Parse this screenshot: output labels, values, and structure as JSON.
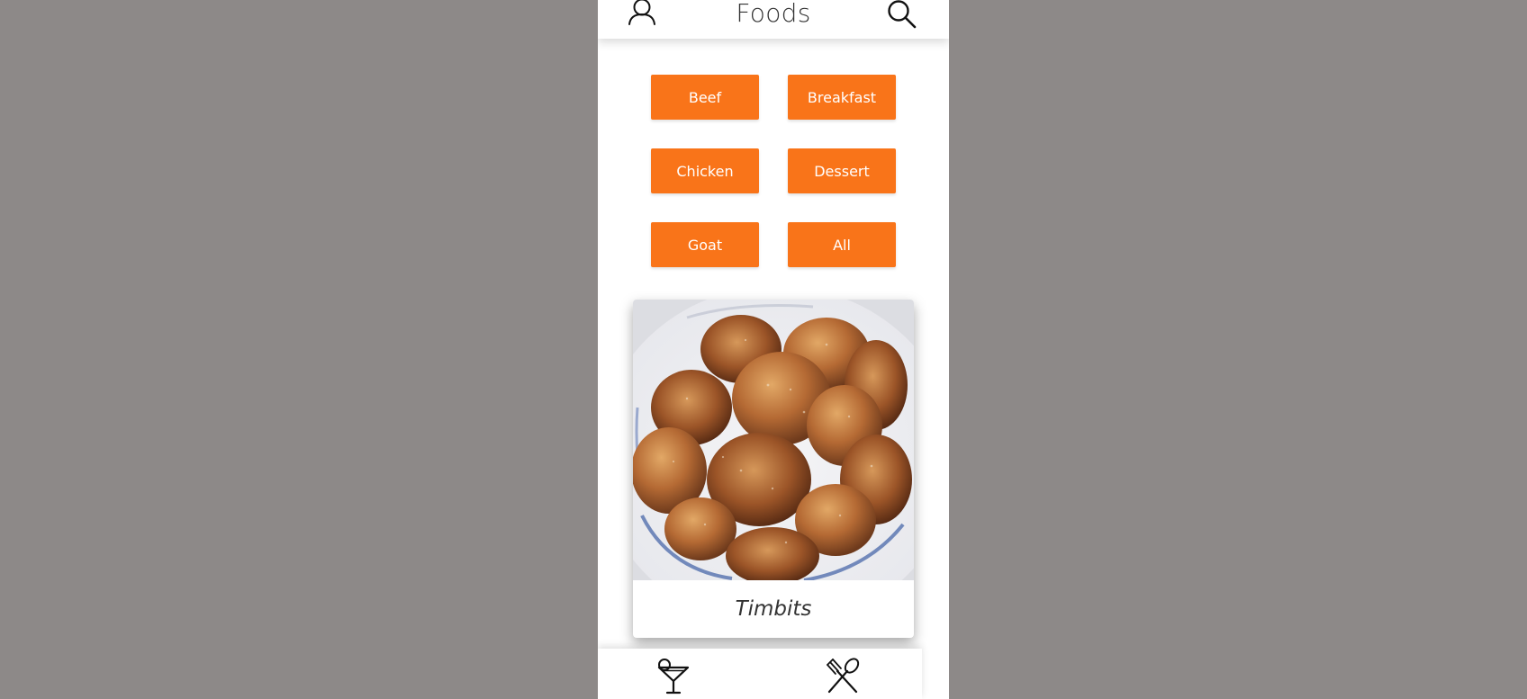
{
  "header": {
    "title": "Foods",
    "user_icon": "user-icon",
    "search_icon": "search-icon"
  },
  "categories": [
    "Beef",
    "Breakfast",
    "Chicken",
    "Dessert",
    "Goat",
    "All"
  ],
  "card": {
    "name": "Timbits"
  },
  "bottom_nav": {
    "items": [
      {
        "icon": "cocktail-icon"
      },
      {
        "icon": "fork-spoon-icon"
      }
    ]
  },
  "colors": {
    "background": "#8d8988",
    "accent": "#f97419",
    "text": "#333333"
  }
}
